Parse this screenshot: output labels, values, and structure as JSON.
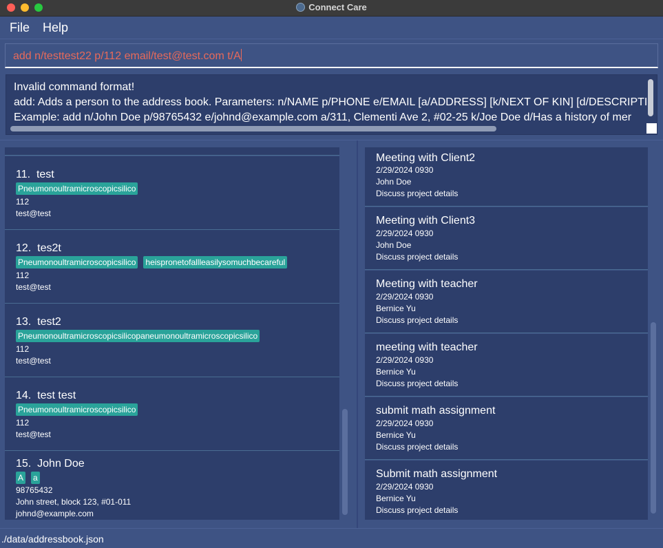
{
  "window": {
    "title": "Connect Care"
  },
  "menu": {
    "file": "File",
    "help": "Help"
  },
  "command": {
    "value": "add n/testtest22 p/112 email/test@test.com t/A"
  },
  "result": {
    "lines": [
      "Invalid command format!",
      "add: Adds a person to the address book. Parameters: n/NAME p/PHONE e/EMAIL [a/ADDRESS] [k/NEXT OF KIN] [d/DESCRIPTI",
      "Example: add n/John Doe p/98765432 e/johnd@example.com a/311, Clementi Ave 2, #02-25 k/Joe Doe d/Has a history of mer"
    ]
  },
  "persons": [
    {
      "index": "11.",
      "name": "test",
      "tags": [
        "Pneumonoultramicroscopicsilico"
      ],
      "phone": "112",
      "email": "test@test"
    },
    {
      "index": "12.",
      "name": "tes2t",
      "tags": [
        "Pneumonoultramicroscopicsilico",
        "heispronetofallleasilysomuchbecareful"
      ],
      "phone": "112",
      "email": "test@test"
    },
    {
      "index": "13.",
      "name": "test2",
      "tags": [
        "Pneumonoultramicroscopicsilicopaneumonoultramicroscopicsilico"
      ],
      "phone": "112",
      "email": "test@test"
    },
    {
      "index": "14.",
      "name": "test test",
      "tags": [
        "Pneumonoultramicroscopicsilico"
      ],
      "phone": "112",
      "email": "test@test"
    },
    {
      "index": "15.",
      "name": "John Doe",
      "tags": [
        "A",
        "a"
      ],
      "phone": "98765432",
      "address": "John street, block 123, #01-011",
      "email": "johnd@example.com"
    }
  ],
  "events": [
    {
      "title": "Meeting with Client2",
      "datetime": "2/29/2024 0930",
      "person": "John Doe",
      "description": "Discuss project details"
    },
    {
      "title": "Meeting with Client3",
      "datetime": "2/29/2024 0930",
      "person": "John Doe",
      "description": "Discuss project details"
    },
    {
      "title": "Meeting with teacher",
      "datetime": "2/29/2024 0930",
      "person": "Bernice Yu",
      "description": "Discuss project details"
    },
    {
      "title": "meeting with teacher",
      "datetime": "2/29/2024 0930",
      "person": "Bernice Yu",
      "description": "Discuss project details"
    },
    {
      "title": "submit math assignment",
      "datetime": "2/29/2024 0930",
      "person": "Bernice Yu",
      "description": "Discuss project details"
    },
    {
      "title": "Submit math assignment",
      "datetime": "2/29/2024 0930",
      "person": "Bernice Yu",
      "description": "Discuss project details"
    }
  ],
  "status": {
    "path": "./data/addressbook.json"
  },
  "colors": {
    "background": "#3e5384",
    "card": "#2d3e6b",
    "tag": "#2aa39a",
    "command_text": "#e86a5a"
  }
}
